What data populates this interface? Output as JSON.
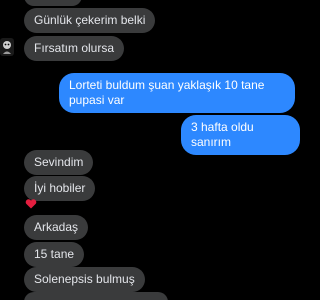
{
  "conversation": {
    "incoming_top": [
      {
        "text": "Günlük çekerim belki"
      },
      {
        "text": "Fırsatım olursa"
      }
    ],
    "outgoing": [
      {
        "text": "Lorteti buldum şuan yaklaşık 10 tane pupasi var"
      },
      {
        "text": "3 hafta oldu sanırım"
      }
    ],
    "incoming_bottom": [
      {
        "text": "Sevindim"
      },
      {
        "text": "İyi hobiler"
      },
      {
        "text": "Arkadaş"
      },
      {
        "text": "15 tane"
      },
      {
        "text": "Solenepsis bulmuş"
      }
    ],
    "reaction": {
      "icon": "heart-icon",
      "color": "#e41e3f"
    },
    "colors": {
      "background": "#000000",
      "incoming_bubble": "#3a3b3c",
      "outgoing_bubble": "#2d88ff"
    }
  }
}
